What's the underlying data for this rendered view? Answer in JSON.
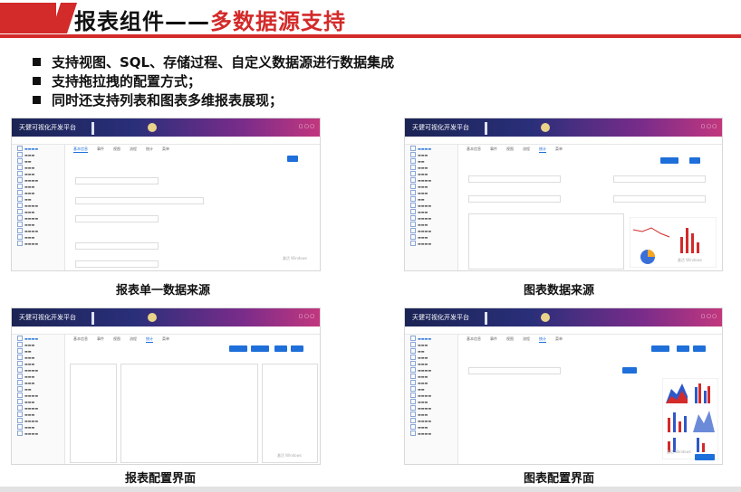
{
  "title": {
    "prefix": "报表组件——",
    "highlight": "多数据源支持"
  },
  "bullets": [
    "支持视图、SQL、存储过程、自定义数据源进行数据集成",
    "支持拖拉拽的配置方式；",
    "同时还支持列表和图表多维报表展现；"
  ],
  "screens": [
    {
      "caption": "报表单一数据来源",
      "app_title": "天健可视化开发平台",
      "tabs": [
        "基本信息",
        "事件",
        "视图",
        "流程",
        "统计",
        "菜单"
      ],
      "watermark": "激活 Windows"
    },
    {
      "caption": "图表数据来源",
      "app_title": "天健可视化开发平台",
      "tabs": [
        "基本信息",
        "事件",
        "视图",
        "流程",
        "统计",
        "菜单"
      ],
      "watermark": "激活 Windows"
    },
    {
      "caption": "报表配置界面",
      "app_title": "天健可视化开发平台",
      "tabs": [
        "基本信息",
        "事件",
        "视图",
        "流程",
        "统计",
        "菜单"
      ],
      "watermark": "激活 Windows"
    },
    {
      "caption": "图表配置界面",
      "app_title": "天健可视化开发平台",
      "tabs": [
        "基本信息",
        "事件",
        "视图",
        "流程",
        "统计",
        "菜单"
      ],
      "watermark": "激活 Windows"
    }
  ],
  "colors": {
    "accent": "#d32a2a",
    "header_gradient_start": "#1b2454",
    "header_gradient_end": "#c2377e",
    "primary_button": "#1e6fd9"
  }
}
